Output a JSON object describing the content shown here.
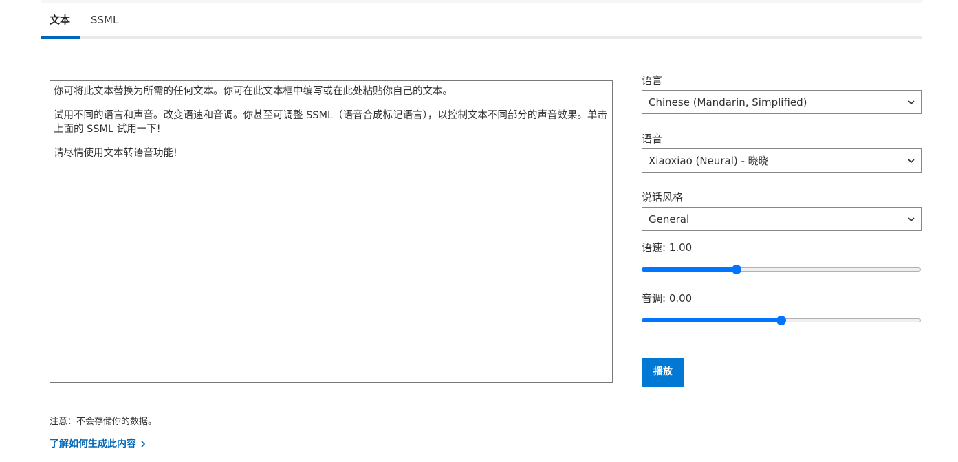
{
  "tabs": [
    {
      "label": "文本",
      "active": true
    },
    {
      "label": "SSML",
      "active": false
    }
  ],
  "editor": {
    "paragraphs": [
      "你可将此文本替换为所需的任何文本。你可在此文本框中编写或在此处粘贴你自己的文本。",
      "试用不同的语言和声音。改变语速和音调。你甚至可调整 SSML（语音合成标记语言），以控制文本不同部分的声音效果。单击上面的 SSML 试用一下!",
      "请尽情使用文本转语音功能!"
    ]
  },
  "language": {
    "label": "语言",
    "value": "Chinese (Mandarin, Simplified)"
  },
  "voice": {
    "label": "语音",
    "value": "Xiaoxiao (Neural) - 晓晓"
  },
  "style": {
    "label": "说话风格",
    "value": "General"
  },
  "rate": {
    "label": "语速: 1.00",
    "value": 1.0,
    "min": 0,
    "max": 3
  },
  "pitch": {
    "label": "音调: 0.00",
    "value": 0.0,
    "min": -0.5,
    "max": 0.5
  },
  "play_button": {
    "label": "播放"
  },
  "footer": {
    "note": "注意：不会存储你的数据。",
    "learn_link": "了解如何生成此内容"
  },
  "colors": {
    "accent": "#0078d4",
    "slider_accent": "#0075ff",
    "link": "#0067b8"
  }
}
